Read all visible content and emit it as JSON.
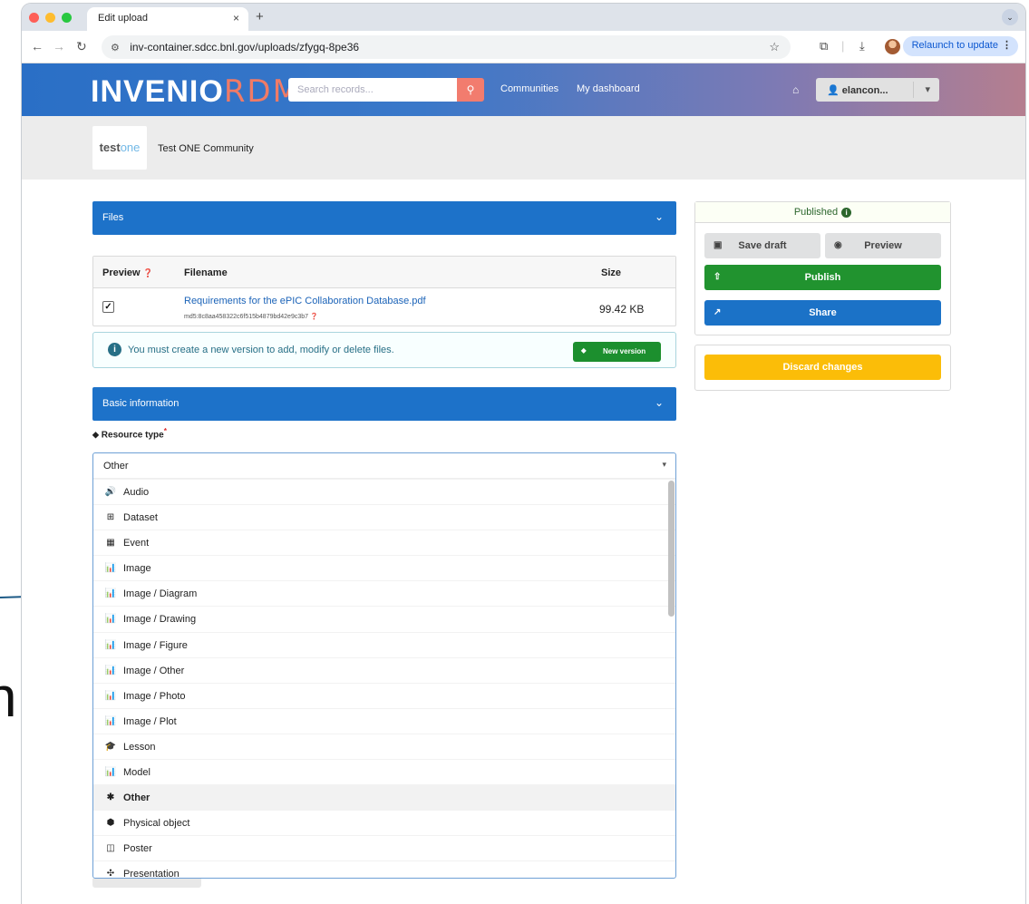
{
  "browser": {
    "tab_title": "Edit upload",
    "tab_close": "×",
    "new_tab": "+",
    "url": "inv-container.sdcc.bnl.gov/uploads/zfygq-8pe36",
    "relaunch_label": "Relaunch to update"
  },
  "header": {
    "logo_left": "INVENIO",
    "logo_right": "RDM",
    "search_placeholder": "Search records...",
    "nav": [
      "Communities",
      "My dashboard"
    ],
    "user": "elancon..."
  },
  "community": {
    "logo_a": "test",
    "logo_b": "one",
    "name": "Test ONE Community"
  },
  "files": {
    "section_title": "Files",
    "col_preview": "Preview",
    "col_filename": "Filename",
    "col_size": "Size",
    "file_name": "Requirements for the ePIC Collaboration Database.pdf",
    "file_md5": "md5:8c8aa458322c6f515b4879bd42e9c3b7",
    "file_size": "99.42 KB",
    "preview_checked": true,
    "info_message": "You must create a new version to add, modify or delete files.",
    "new_version_label": "New version"
  },
  "basic": {
    "section_title": "Basic information",
    "resource_type_label": "Resource type",
    "required_mark": "*",
    "selected": "Other",
    "options": [
      {
        "label": "Audio",
        "icon": "audio-icon",
        "glyph": "🔊"
      },
      {
        "label": "Dataset",
        "icon": "table-icon",
        "glyph": "⊞"
      },
      {
        "label": "Event",
        "icon": "calendar-icon",
        "glyph": "▦"
      },
      {
        "label": "Image",
        "icon": "chart-icon",
        "glyph": "📊"
      },
      {
        "label": "Image / Diagram",
        "icon": "chart-icon",
        "glyph": "📊"
      },
      {
        "label": "Image / Drawing",
        "icon": "chart-icon",
        "glyph": "📊"
      },
      {
        "label": "Image / Figure",
        "icon": "chart-icon",
        "glyph": "📊"
      },
      {
        "label": "Image / Other",
        "icon": "chart-icon",
        "glyph": "📊"
      },
      {
        "label": "Image / Photo",
        "icon": "chart-icon",
        "glyph": "📊"
      },
      {
        "label": "Image / Plot",
        "icon": "chart-icon",
        "glyph": "📊"
      },
      {
        "label": "Lesson",
        "icon": "graduation-cap-icon",
        "glyph": "🎓"
      },
      {
        "label": "Model",
        "icon": "chart-icon",
        "glyph": "📊"
      },
      {
        "label": "Other",
        "icon": "asterisk-icon",
        "glyph": "✱"
      },
      {
        "label": "Physical object",
        "icon": "cube-icon",
        "glyph": "⬢"
      },
      {
        "label": "Poster",
        "icon": "poster-icon",
        "glyph": "◫"
      },
      {
        "label": "Presentation",
        "icon": "presentation-icon",
        "glyph": "✣"
      }
    ]
  },
  "sidebar": {
    "status": "Published",
    "save_draft": "Save draft",
    "preview": "Preview",
    "publish": "Publish",
    "share": "Share",
    "discard": "Discard changes"
  },
  "annotation": {
    "letter": "n"
  },
  "colors": {
    "accent_blue": "#1d72c9",
    "publish_green": "#21932f",
    "discard_yellow": "#fbbd08",
    "logo_coral": "#f07b66"
  }
}
